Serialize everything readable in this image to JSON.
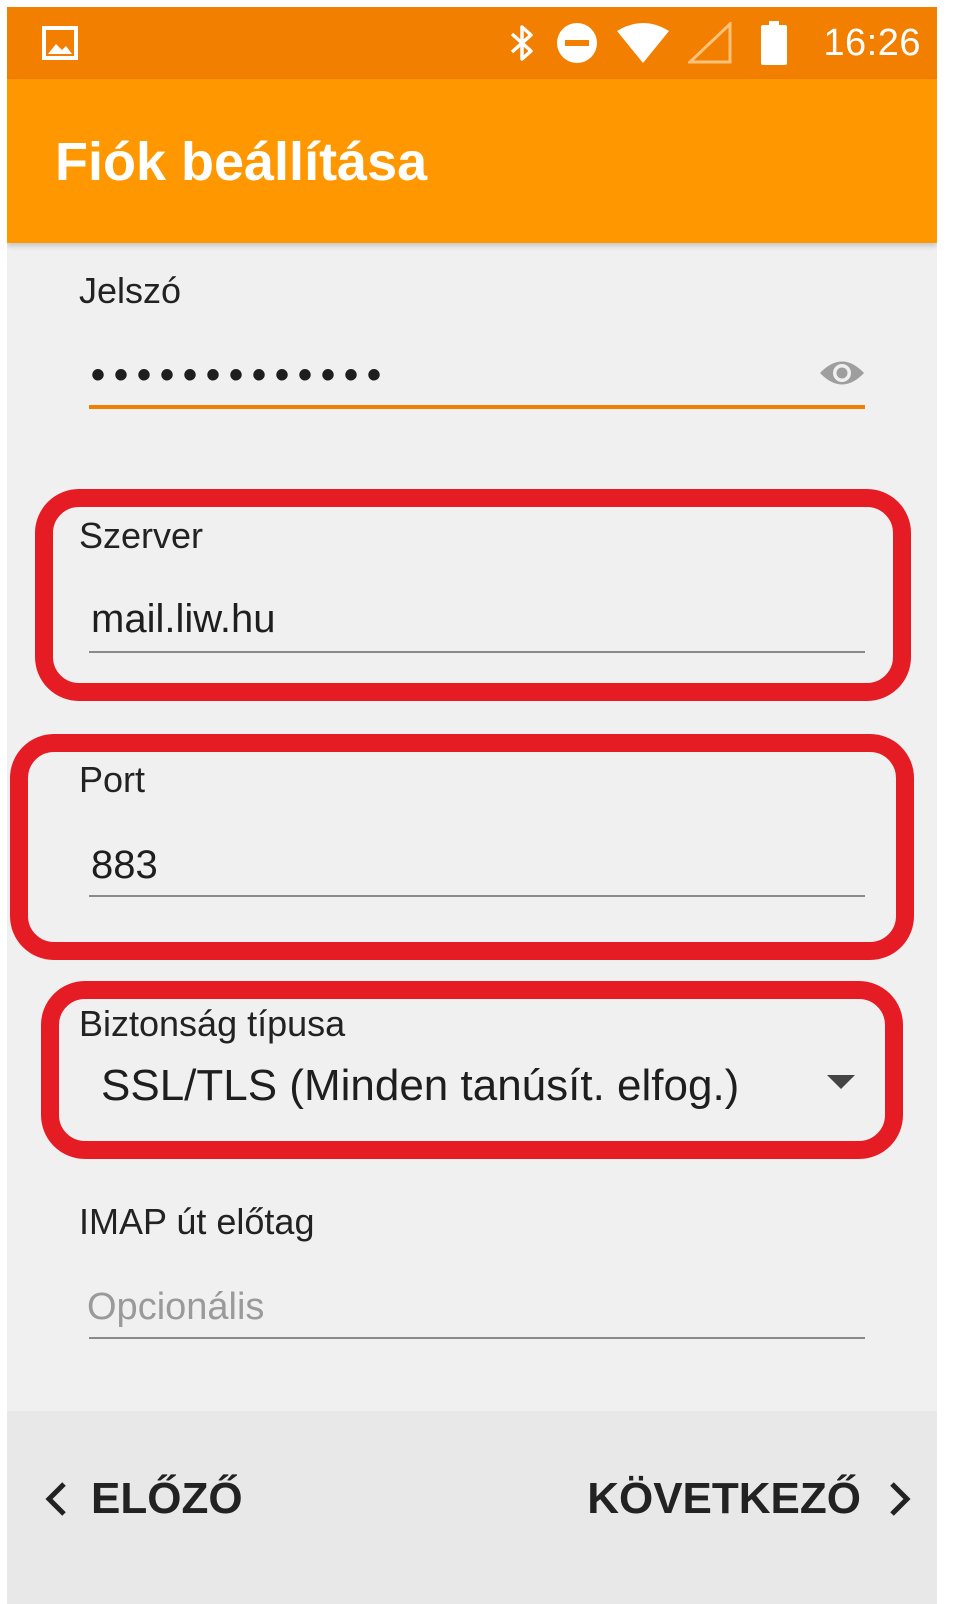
{
  "status_bar": {
    "time": "16:26",
    "icons": [
      "image-icon",
      "bluetooth-icon",
      "do-not-disturb-icon",
      "wifi-icon",
      "signal-icon",
      "battery-icon"
    ]
  },
  "app_bar": {
    "title": "Fiók beállítása"
  },
  "form": {
    "password": {
      "label": "Jelszó",
      "masked_value": "•••••••••••••"
    },
    "server": {
      "label": "Szerver",
      "value": "mail.liw.hu"
    },
    "port": {
      "label": "Port",
      "value": "883"
    },
    "security_type": {
      "label": "Biztonság típusa",
      "selected": "SSL/TLS (Minden tanúsít. elfog.)"
    },
    "imap_prefix": {
      "label": "IMAP út előtag",
      "placeholder": "Opcionális"
    }
  },
  "footer": {
    "prev_label": "ELŐZŐ",
    "next_label": "KÖVETKEZŐ"
  },
  "colors": {
    "status_bar": "#f27f00",
    "app_bar": "#ff9800",
    "accent": "#f27f00",
    "highlight": "#e51c23"
  }
}
